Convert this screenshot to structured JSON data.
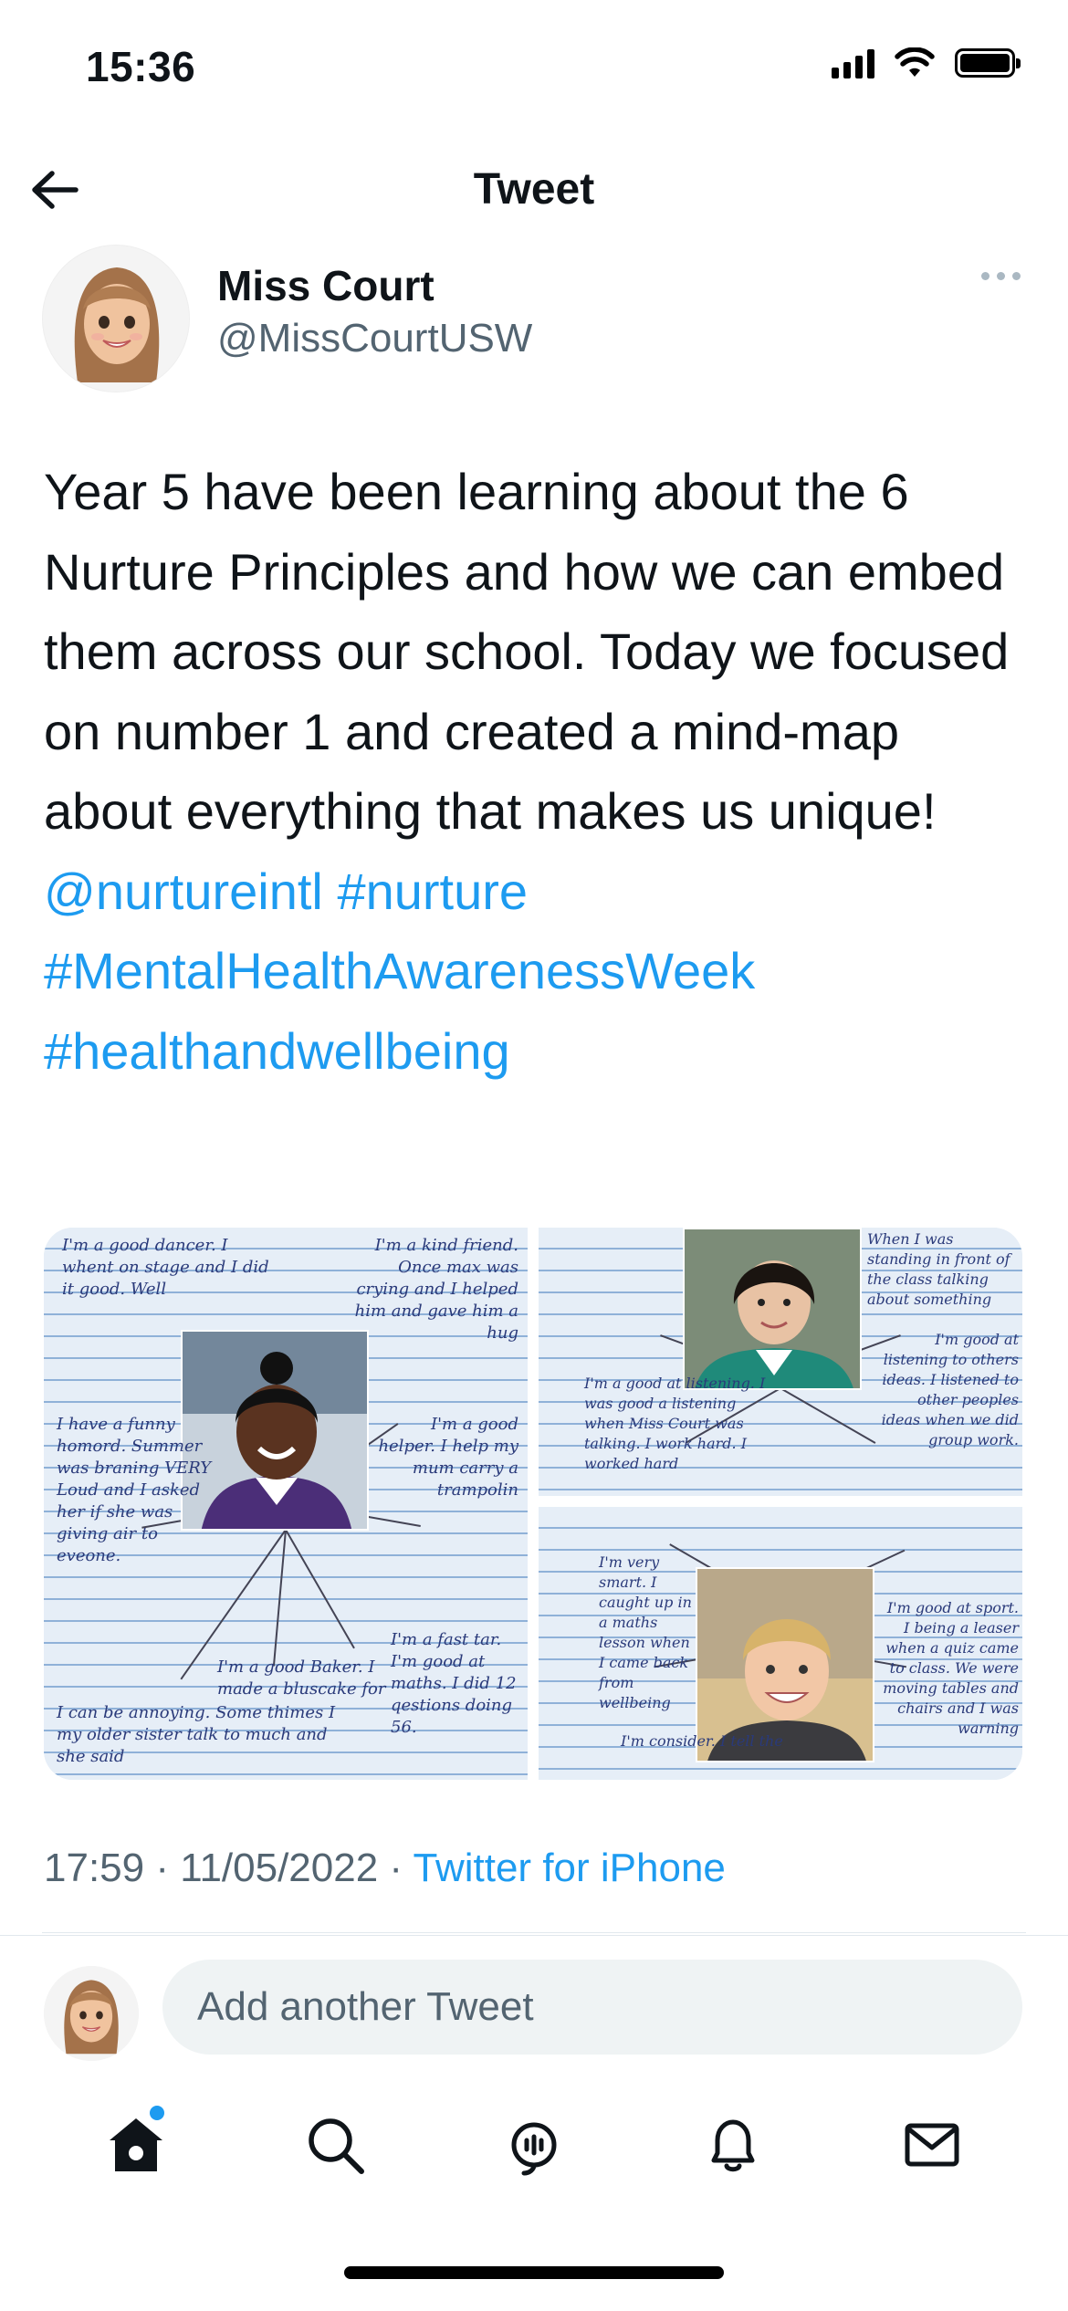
{
  "status_bar": {
    "time": "15:36"
  },
  "header": {
    "title": "Tweet",
    "back_icon": "arrow-left-icon"
  },
  "author": {
    "name": "Miss Court",
    "handle": "@MissCourtUSW"
  },
  "tweet": {
    "text": "Year 5 have been learning about the 6 Nurture Principles and how we can embed them across our school. Today we focused on number 1 and created a mind-map about everything that makes us unique!",
    "mention": "@nurtureintl",
    "hashtags": [
      "#nurture",
      "#MentalHealthAwarenessWeek",
      "#healthandwellbeing"
    ]
  },
  "media": {
    "image_1": {
      "notes": [
        "I'm a good dancer. I whent on stage and I did it good. Well",
        "I'm a kind friend. Once max was crying and I helped him and gave him a hug",
        "I have a funny homord. Summer was braning VERY Loud and I asked her if she was giving air to eveone.",
        "I'm a good helper. I help my mum carry a trampolin",
        "I'm a good Baker. I made a bluscake for",
        "I'm a fast tar. I'm good at maths. I did 12 qestions doing 56.",
        "I can be annoying. Some thimes I my older sister talk to much and she said"
      ]
    },
    "image_2": {
      "notes": [
        "When I was standing in front of the class talking about something",
        "I'm a good at listening. I was good a listening when Miss Court was talking. I work hard. I worked hard",
        "I'm good at listening to others ideas. I listened to other peoples ideas when we did group work."
      ]
    },
    "image_3": {
      "notes": [
        "I'm very smart. I caught up in a maths lesson when I came back from wellbeing",
        "I'm good at sport. I being a leaser when a quiz came to class. We were moving tables and chairs and I was warning",
        "I'm consider. I tell the"
      ]
    }
  },
  "meta": {
    "time": "17:59",
    "separator": "·",
    "date": "11/05/2022",
    "source": "Twitter for iPhone"
  },
  "reply": {
    "placeholder": "Add another Tweet"
  },
  "tab_bar": {
    "tabs": [
      {
        "name": "home",
        "icon": "home-icon",
        "notification": true
      },
      {
        "name": "search",
        "icon": "search-icon",
        "notification": false
      },
      {
        "name": "spaces",
        "icon": "spaces-icon",
        "notification": false
      },
      {
        "name": "notifications",
        "icon": "bell-icon",
        "notification": false
      },
      {
        "name": "messages",
        "icon": "mail-icon",
        "notification": false
      }
    ]
  }
}
